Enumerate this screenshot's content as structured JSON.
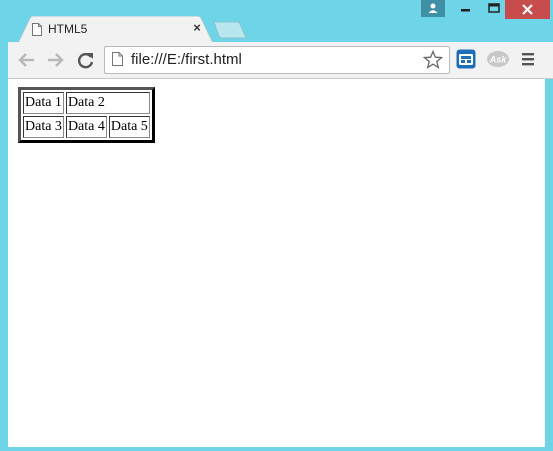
{
  "browser": {
    "tab_title": "HTML5",
    "close_glyph": "×",
    "address": "file:///E:/first.html"
  },
  "table": {
    "rows": [
      [
        "Data 1",
        "Data 2"
      ],
      [
        "Data 3",
        "Data 4",
        "Data 5"
      ]
    ]
  },
  "colors": {
    "frame": "#6ed5e8",
    "close_button": "#c94c4c"
  },
  "icons": [
    "page-icon",
    "close-icon",
    "back-arrow-icon",
    "forward-arrow-icon",
    "reload-icon",
    "star-icon",
    "extension-icon",
    "ask-icon",
    "menu-icon",
    "user-icon",
    "minimize-icon",
    "maximize-icon"
  ]
}
